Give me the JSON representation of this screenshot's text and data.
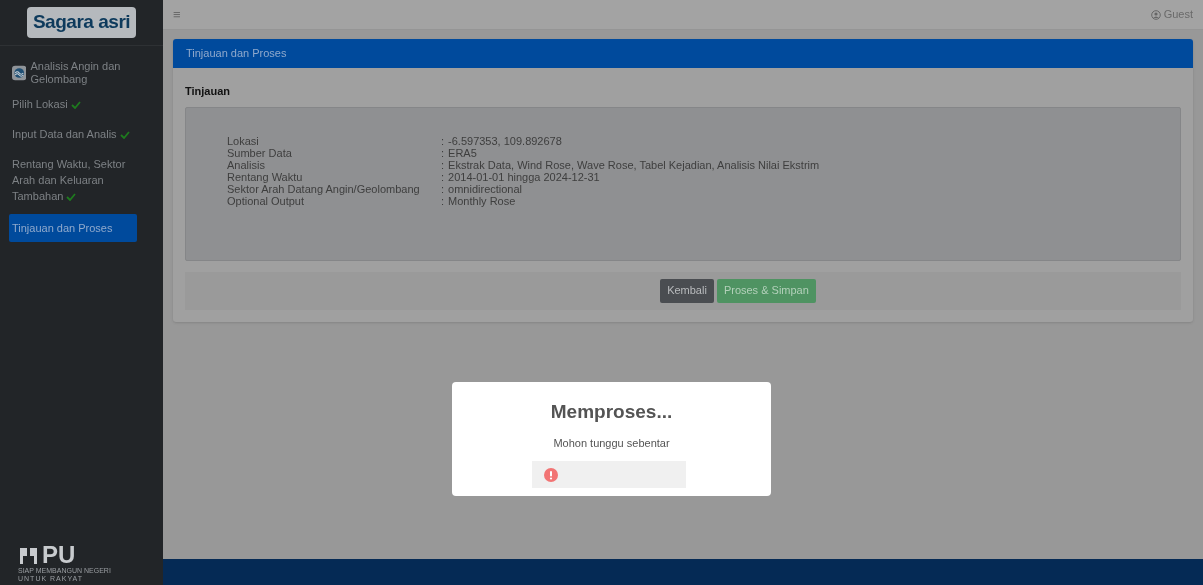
{
  "sidebar": {
    "logo": "Sagara asri",
    "module": "Analisis Angin dan Gelombang",
    "steps": [
      {
        "label": "Pilih Lokasi",
        "done": true,
        "selected": false
      },
      {
        "label": "Input Data dan Analis",
        "done": true,
        "selected": false
      },
      {
        "label": "Rentang Waktu, Sektor Arah dan Keluaran Tambahan",
        "done": true,
        "selected": false
      },
      {
        "label": "Tinjauan dan Proses",
        "done": false,
        "selected": true
      }
    ],
    "footer_logo": {
      "mark": "PU",
      "tagline_1": "SIAP MEMBANGUN NEGERI",
      "tagline_2": "UNTUK RAKYAT"
    }
  },
  "topbar": {
    "menu_glyph": "≡",
    "user": "Guest"
  },
  "panel": {
    "title": "Tinjauan dan Proses",
    "section": "Tinjauan",
    "review": [
      {
        "label": "Lokasi",
        "value": "-6.597353, 109.892678"
      },
      {
        "label": "Sumber Data",
        "value": "ERA5"
      },
      {
        "label": "Analisis",
        "value": "Ekstrak Data, Wind Rose, Wave Rose, Tabel Kejadian, Analisis Nilai Ekstrim"
      },
      {
        "label": "Rentang Waktu",
        "value": "2014-01-01 hingga 2024-12-31"
      },
      {
        "label": "Sektor Arah Datang Angin/Geolombang",
        "value": "omnidirectional"
      },
      {
        "label": "Optional Output",
        "value": "Monthly Rose"
      }
    ],
    "separator": ":",
    "buttons": [
      {
        "label": "Kembali",
        "kind": "secondary"
      },
      {
        "label": "Proses & Simpan",
        "kind": "primary"
      }
    ]
  },
  "modal": {
    "title": "Memproses...",
    "message": "Mohon tunggu sebentar"
  }
}
